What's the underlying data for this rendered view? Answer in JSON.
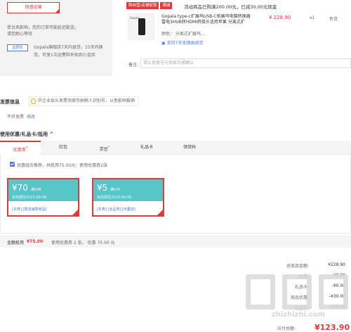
{
  "shipping": {
    "method_label": "快递运输",
    "note_line1": "受台风影响，您的订单可能延迟配送，",
    "note_line2": "请您耐心等待",
    "return_badge": "运费险",
    "return_text": "Gopala旗舰店7天内退货，15天内换货，可享1次运费险补贴到小金库"
  },
  "goods": {
    "tag_shop": "跨自营/店铺促销",
    "tag_promo": "满减",
    "promo_text": "活动商品已购满200.00元，已减30.00元现金",
    "thumb_label": "Gopala",
    "title": "Gopala type-c扩展坞USB-C拓展坞电脑转换器雷电3HUB转HDMI转接头适用苹果 分离式扩",
    "color": "颜色： 分离式扩展坞...",
    "service": "支持7天无理由退货",
    "price": "¥ 228.90",
    "qty": "x1",
    "stock": "有货"
  },
  "remark": {
    "label": "备注:",
    "placeholder": "请认真留言与商家沟通确认"
  },
  "invoice": {
    "title": "发票信息",
    "tip": "开企业抬头发票须填写纳税人识别号，以免影响报销",
    "value": "不开发票",
    "edit": "修改"
  },
  "coupons": {
    "section_title": "使用优惠/礼品卡/抵用 ^",
    "tabs": [
      {
        "label": "优惠券",
        "mark": "*"
      },
      {
        "label": "红包",
        "mark": ""
      },
      {
        "label": "京豆",
        "mark": "*"
      },
      {
        "label": "礼品卡",
        "mark": ""
      },
      {
        "label": "领货码",
        "mark": ""
      }
    ],
    "recommend_text": "优惠组合推荐，共抵用75.00元：使用优惠券2张",
    "items": [
      {
        "amount": "¥70",
        "condition": "满198",
        "date": "有效期至2023-09-08",
        "tags": "[东券] [限店铺限商品]"
      },
      {
        "amount": "¥5",
        "condition": "满105",
        "date": "有效期至2023-09-06",
        "tags": "[东券] [全品类] [可叠加]"
      }
    ]
  },
  "totals_bar": {
    "label": "金额抵用",
    "amount": "¥75.00",
    "detail": "使用优惠券 2 张， 优惠 75.00 元"
  },
  "summary": {
    "rows": [
      {
        "k": "总商品金额:",
        "v": "¥228.90"
      },
      {
        "k": "运费:",
        "v": "¥0.00"
      },
      {
        "k": "礼品卡:",
        "v": "-¥0.00"
      },
      {
        "k": "商品优惠:",
        "v": "-¥30.00"
      },
      {
        "k": "优惠券:",
        "v": "-¥75.00"
      }
    ],
    "payable_label": "应付总额:",
    "payable_value": "¥123.90"
  },
  "watermark": {
    "url": "zhizhizhi.com"
  }
}
